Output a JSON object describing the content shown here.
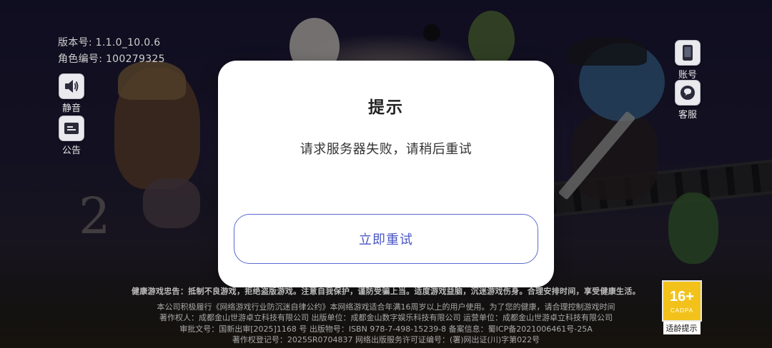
{
  "info": {
    "version": "版本号: 1.1.0_10.0.6",
    "role_id": "角色编号:  100279325"
  },
  "left_buttons": {
    "mute_label": "静音",
    "notice_label": "公告"
  },
  "right_buttons": {
    "account_label": "账号",
    "service_label": "客服"
  },
  "dialog": {
    "title": "提示",
    "message": "请求服务器失败，请稍后重试",
    "retry_label": "立即重试"
  },
  "footer": {
    "health_notice": "健康游戏忠告：抵制不良游戏，拒绝盗版游戏。注意自我保护，谨防受骗上当。适度游戏益脑，沉迷游戏伤身。合理安排时间，享受健康生活。",
    "line1": "本公司积极履行《网络游戏行业防沉迷自律公约》本网络游戏适合年满16周岁以上的用户使用。为了您的健康，请合理控制游戏时间",
    "line2": "著作权人：成都金山世游卓立科技有限公司 出版单位：成都金山数字娱乐科技有限公司 运营单位：成都金山世游卓立科技有限公司",
    "line3": "审批文号：国新出审[2025]1168 号 出版物号：ISBN 978-7-498-15239-8 备案信息：蜀ICP备2021006461号-25A",
    "line4": "著作权登记号：2025SR0704837 网络出版服务许可证编号：(署)网出证(川)字第022号"
  },
  "age_rating": {
    "rating": "16+",
    "org": "CADPA",
    "caption": "适龄提示"
  },
  "colors": {
    "accent": "#4856c4",
    "dialog_bg": "#ffffff",
    "badge_yellow": "#f2c21b"
  },
  "icons": {
    "mute": "speaker-icon",
    "notice": "bulletin-icon",
    "account": "phone-icon",
    "service": "chat-icon"
  }
}
